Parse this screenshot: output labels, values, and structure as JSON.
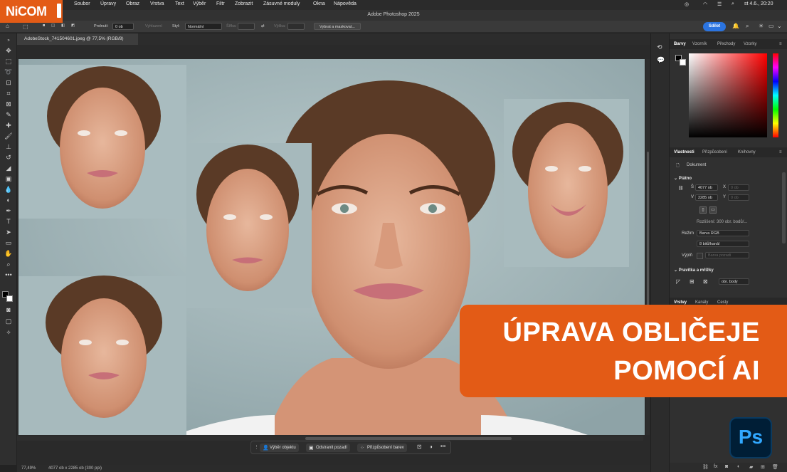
{
  "logo": {
    "text": "NiCOM"
  },
  "menubar": {
    "items": [
      "Soubor",
      "Úpravy",
      "Obraz",
      "Vrstva",
      "Text",
      "Výběr",
      "Filtr",
      "Zobrazit",
      "Zásuvné moduly",
      "Okna",
      "Nápověda"
    ],
    "clock": "st 4.6., 20:20"
  },
  "titlebar": {
    "title": "Adobe Photoshop 2025"
  },
  "options": {
    "feather_label": "Prolnutí:",
    "feather_value": "0 ob",
    "antialias_label": "Vyhlazení",
    "style_label": "Styl:",
    "style_value": "Normální",
    "width_label": "Šířka:",
    "height_label": "Výška:",
    "select_mask_label": "Vybrat a maskovat...",
    "share_label": "Sdílet"
  },
  "document": {
    "tab_title": "AdobeStock_741504601.jpeg @ 77,5% (RGB/8)"
  },
  "context_bar": {
    "select_subject": "Výběr objektu",
    "remove_bg": "Odstranit pozadí",
    "color_adjust": "Přizpůsobení barev",
    "more": "•••"
  },
  "status": {
    "zoom": "77,49%",
    "doc_info": "4077 ob x 2285 ob (300 ppi)"
  },
  "color_panel": {
    "tabs": [
      "Barvy",
      "Vzorník",
      "Přechody",
      "Vzorky"
    ]
  },
  "properties_panel": {
    "tabs": [
      "Vlastnosti",
      "Přizpůsobení",
      "Knihovny"
    ],
    "doc_label": "Dokument",
    "canvas_section": "Plátno",
    "w_label": "Š",
    "w_value": "4077 ob",
    "h_label": "V",
    "h_value": "2285 ob",
    "x_label": "X",
    "x_value": "0 ob",
    "y_label": "Y",
    "y_value": "0 ob",
    "resolution": "Rozlišení: 300 obr. bodů/...",
    "mode_label": "Režim",
    "mode_value": "Barva RGB",
    "depth_value": "8 bitů/kanál",
    "fill_label": "Výplň",
    "fill_value": "Barva pozadí",
    "rulers_section": "Pravítka a mřížky",
    "units_value": "obr. body"
  },
  "layers_panel": {
    "tabs": [
      "Vrstvy",
      "Kanály",
      "Cesty"
    ]
  },
  "banner": {
    "line1": "ÚPRAVA OBLIČEJE",
    "line2": "POMOCÍ AI"
  },
  "ps_badge": {
    "text": "Ps"
  },
  "colors": {
    "accent": "#e35b16",
    "ps_blue": "#31a8ff",
    "share_blue": "#2b74e0"
  }
}
